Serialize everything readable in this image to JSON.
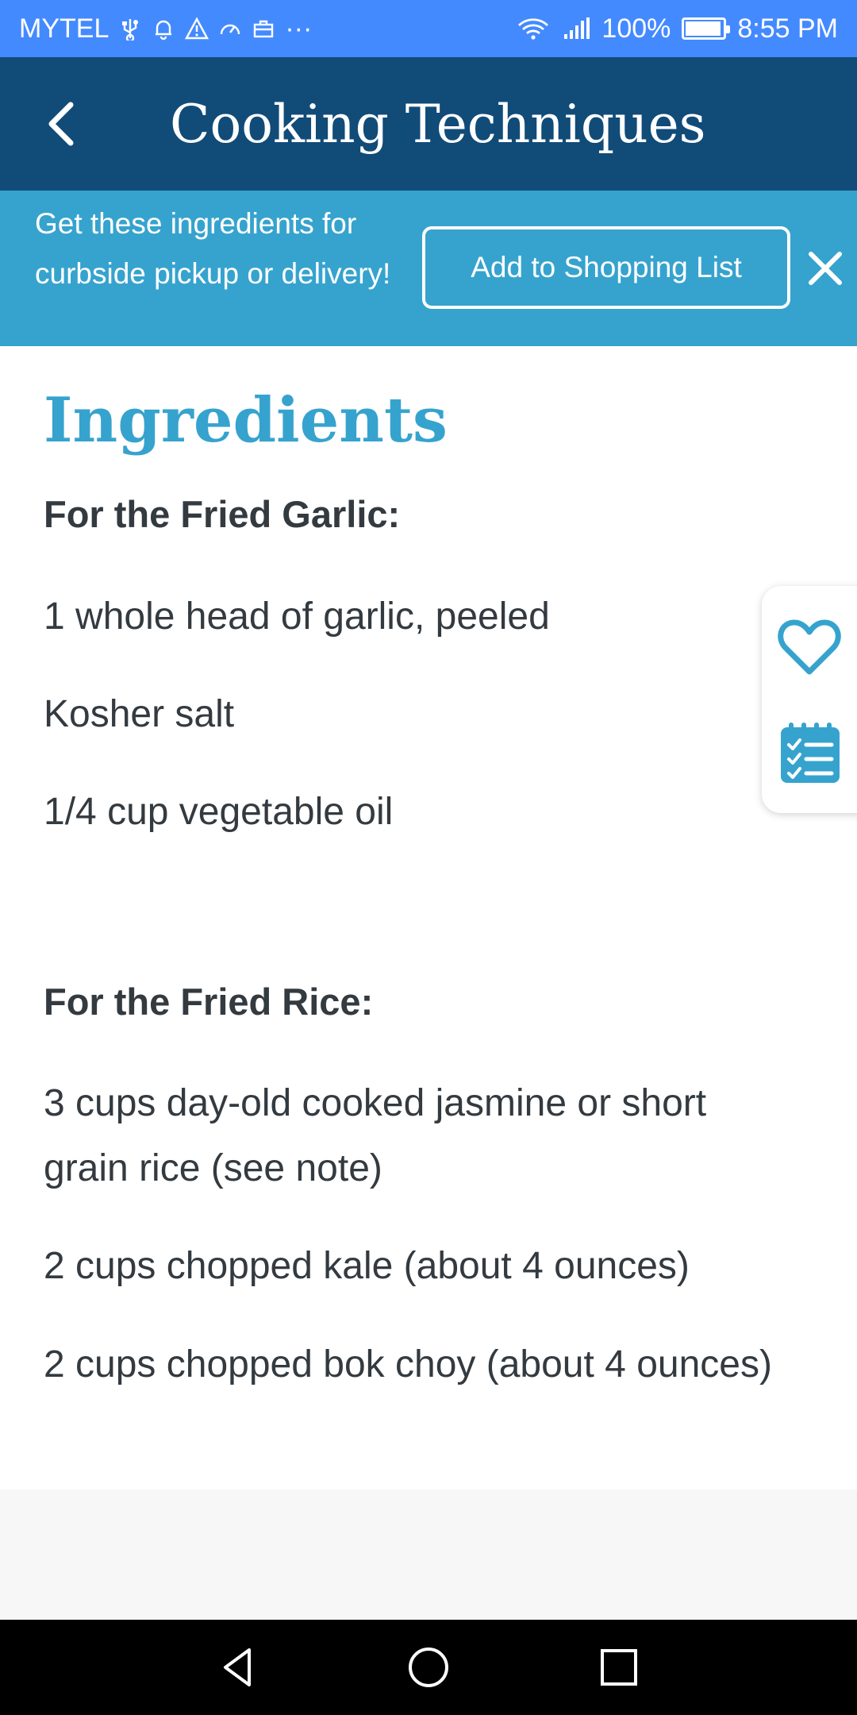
{
  "status_bar": {
    "carrier": "MYTEL",
    "overflow": "···",
    "battery_percent": "100%",
    "battery_level": 1.0,
    "time": "8:55 PM",
    "icons": [
      "usb-icon",
      "bell-icon",
      "warning-icon",
      "speed-icon",
      "briefcase-icon",
      "wifi-icon",
      "signal-icon",
      "battery-icon"
    ]
  },
  "app_bar": {
    "title": "Cooking Techniques",
    "back_icon": "chevron-left-icon"
  },
  "promo": {
    "text": "Get these ingredients for curbside pickup or delivery!",
    "button_label": "Add to Shopping List",
    "close_icon": "close-icon"
  },
  "ingredients": {
    "title": "Ingredients",
    "groups": [
      {
        "heading": "For the Fried Garlic:",
        "items": [
          "1 whole head of garlic, peeled",
          "Kosher salt",
          "1/4 cup vegetable oil"
        ]
      },
      {
        "heading": "For the Fried Rice:",
        "items": [
          "3 cups day-old cooked jasmine or short grain rice (see note)",
          "2 cups chopped kale (about 4 ounces)",
          "2 cups chopped bok choy (about 4 ounces)"
        ]
      }
    ]
  },
  "side_actions": {
    "icons": [
      "heart-icon",
      "checklist-icon"
    ]
  },
  "nav_bar": {
    "icons": [
      "nav-back-icon",
      "nav-home-icon",
      "nav-recents-icon"
    ]
  },
  "colors": {
    "status_bar": "#448aff",
    "app_bar": "#114b78",
    "accent": "#36a3ce",
    "text": "#333a40"
  }
}
